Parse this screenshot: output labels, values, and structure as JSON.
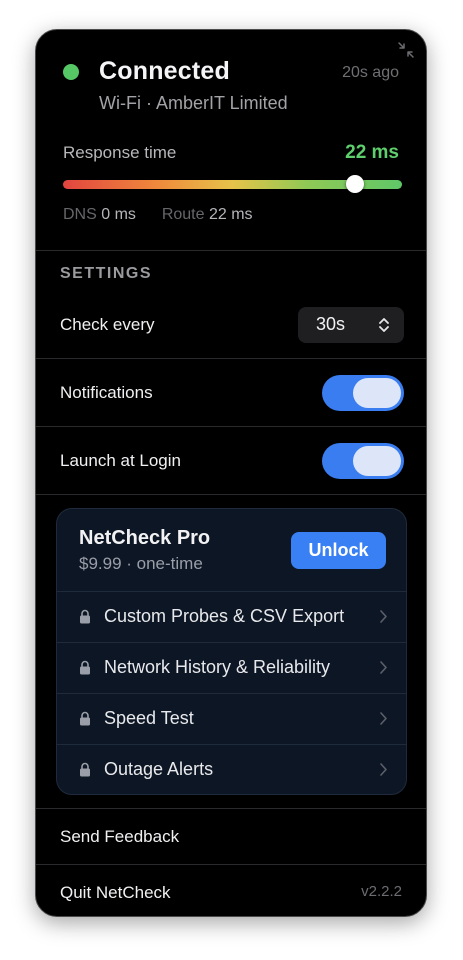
{
  "status": {
    "title": "Connected",
    "updated_ago": "20s ago",
    "subtitle": "Wi-Fi · AmberIT Limited",
    "dot_color": "#55c765"
  },
  "response": {
    "label": "Response time",
    "value": "22 ms",
    "value_color": "#5fcf6d",
    "latency_level": 0.86,
    "dns_label": "DNS",
    "dns_value": "0 ms",
    "route_label": "Route",
    "route_value": "22 ms"
  },
  "settings": {
    "header": "SETTINGS",
    "check_every": {
      "label": "Check every",
      "value": "30s"
    },
    "notifications": {
      "label": "Notifications",
      "enabled": true
    },
    "launch_at_login": {
      "label": "Launch at Login",
      "enabled": true
    }
  },
  "pro": {
    "title": "NetCheck Pro",
    "price": "$9.99 · one-time",
    "unlock_label": "Unlock",
    "accent_color": "#3880f4",
    "features": [
      {
        "label": "Custom Probes & CSV Export",
        "icon": "lock-icon"
      },
      {
        "label": "Network History & Reliability",
        "icon": "lock-icon"
      },
      {
        "label": "Speed Test",
        "icon": "lock-icon"
      },
      {
        "label": "Outage Alerts",
        "icon": "lock-icon"
      }
    ]
  },
  "footer": {
    "feedback_label": "Send Feedback",
    "quit_label": "Quit NetCheck",
    "version": "v2.2.2"
  }
}
